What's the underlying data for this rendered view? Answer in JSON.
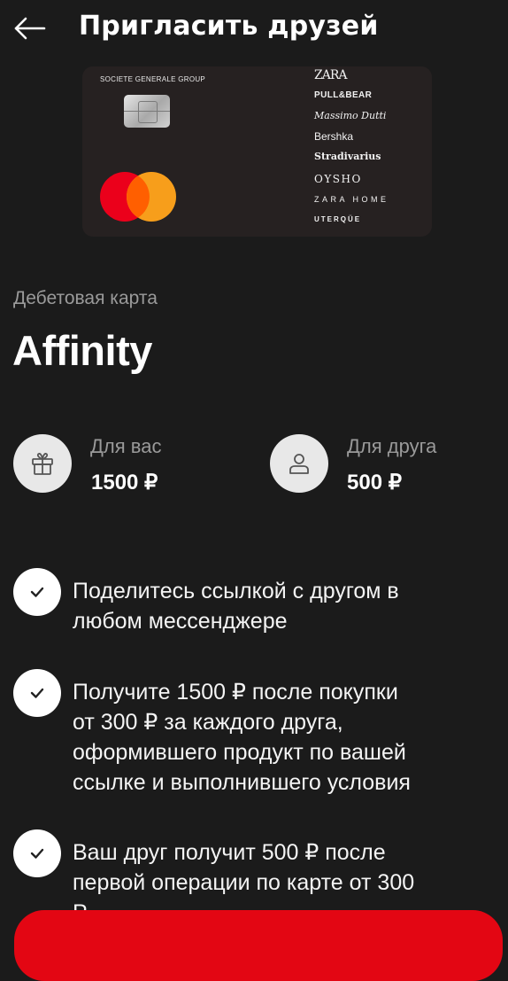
{
  "header": {
    "title": "Пригласить друзей",
    "back_icon": "arrow-left-icon"
  },
  "card": {
    "issuer": "SOCIETE GENERALE GROUP",
    "payment_system": "Mastercard",
    "brands": [
      "ZARA",
      "PULL&BEAR",
      "Massimo Dutti",
      "Bershka",
      "Stradivarius",
      "OYSHO",
      "ZARA HOME",
      "UTERQÜE"
    ]
  },
  "product": {
    "type": "Дебетовая карта",
    "name": "Affinity"
  },
  "rewards": [
    {
      "icon": "gift-icon",
      "label": "Для вас",
      "amount": "1500 ₽"
    },
    {
      "icon": "user-icon",
      "label": "Для друга",
      "amount": "500 ₽"
    }
  ],
  "steps": [
    {
      "icon": "check-icon",
      "text": "Поделитесь ссылкой с другом в\nлюбом мессенджере"
    },
    {
      "icon": "check-icon",
      "text": "Получите 1500 ₽ после покупки\nот 300 ₽ за каждого друга,\nоформившего продукт по вашей\nссылке и выполнившего  условия"
    },
    {
      "icon": "check-icon",
      "text": "Ваш друг получит 500 ₽ после\nпервой операции по карте от 300\nР"
    }
  ],
  "colors": {
    "background": "#1b1b1b",
    "accent": "#e30613",
    "mastercard_red": "#eb001b",
    "mastercard_orange": "#f79e1b"
  }
}
